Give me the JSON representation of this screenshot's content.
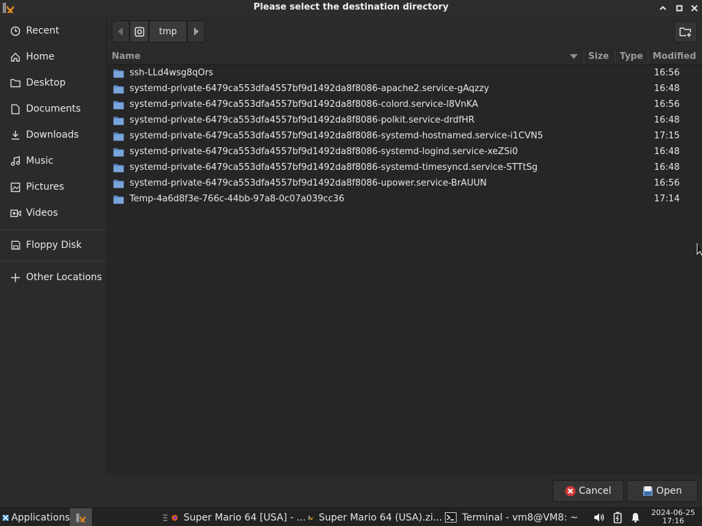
{
  "window": {
    "title": "Please select the destination directory"
  },
  "sidebar": {
    "items": [
      {
        "label": "Recent",
        "icon": "clock-icon"
      },
      {
        "label": "Home",
        "icon": "home-icon"
      },
      {
        "label": "Desktop",
        "icon": "folder-icon"
      },
      {
        "label": "Documents",
        "icon": "document-icon"
      },
      {
        "label": "Downloads",
        "icon": "download-icon"
      },
      {
        "label": "Music",
        "icon": "music-icon"
      },
      {
        "label": "Pictures",
        "icon": "picture-icon"
      },
      {
        "label": "Videos",
        "icon": "video-icon"
      },
      {
        "label": "Floppy Disk",
        "icon": "floppy-icon"
      },
      {
        "label": "Other Locations",
        "icon": "plus-icon"
      }
    ]
  },
  "pathbar": {
    "current": "tmp"
  },
  "columns": {
    "name": "Name",
    "size": "Size",
    "type": "Type",
    "modified": "Modified"
  },
  "files": [
    {
      "name": "ssh-LLd4wsg8qOrs",
      "modified": "16:56"
    },
    {
      "name": "systemd-private-6479ca553dfa4557bf9d1492da8f8086-apache2.service-gAqzzy",
      "modified": "16:48"
    },
    {
      "name": "systemd-private-6479ca553dfa4557bf9d1492da8f8086-colord.service-l8VnKA",
      "modified": "16:56"
    },
    {
      "name": "systemd-private-6479ca553dfa4557bf9d1492da8f8086-polkit.service-drdfHR",
      "modified": "16:48"
    },
    {
      "name": "systemd-private-6479ca553dfa4557bf9d1492da8f8086-systemd-hostnamed.service-i1CVN5",
      "modified": "17:15"
    },
    {
      "name": "systemd-private-6479ca553dfa4557bf9d1492da8f8086-systemd-logind.service-xeZSi0",
      "modified": "16:48"
    },
    {
      "name": "systemd-private-6479ca553dfa4557bf9d1492da8f8086-systemd-timesyncd.service-STTtSg",
      "modified": "16:48"
    },
    {
      "name": "systemd-private-6479ca553dfa4557bf9d1492da8f8086-upower.service-BrAUUN",
      "modified": "16:56"
    },
    {
      "name": "Temp-4a6d8f3e-766c-44bb-97a8-0c07a039cc36",
      "modified": "17:14"
    }
  ],
  "actions": {
    "cancel": "Cancel",
    "open": "Open"
  },
  "taskbar": {
    "applications": "Applications",
    "tasks": [
      {
        "label": "Super Mario 64 [USA] - ...",
        "icon": "firefox-icon"
      },
      {
        "label": "Super Mario 64 (USA).zi...",
        "icon": "app-x-icon"
      },
      {
        "label": "Terminal - vm8@VM8: ~",
        "icon": "terminal-icon"
      }
    ],
    "date": "2024-06-25",
    "time": "17:16"
  }
}
